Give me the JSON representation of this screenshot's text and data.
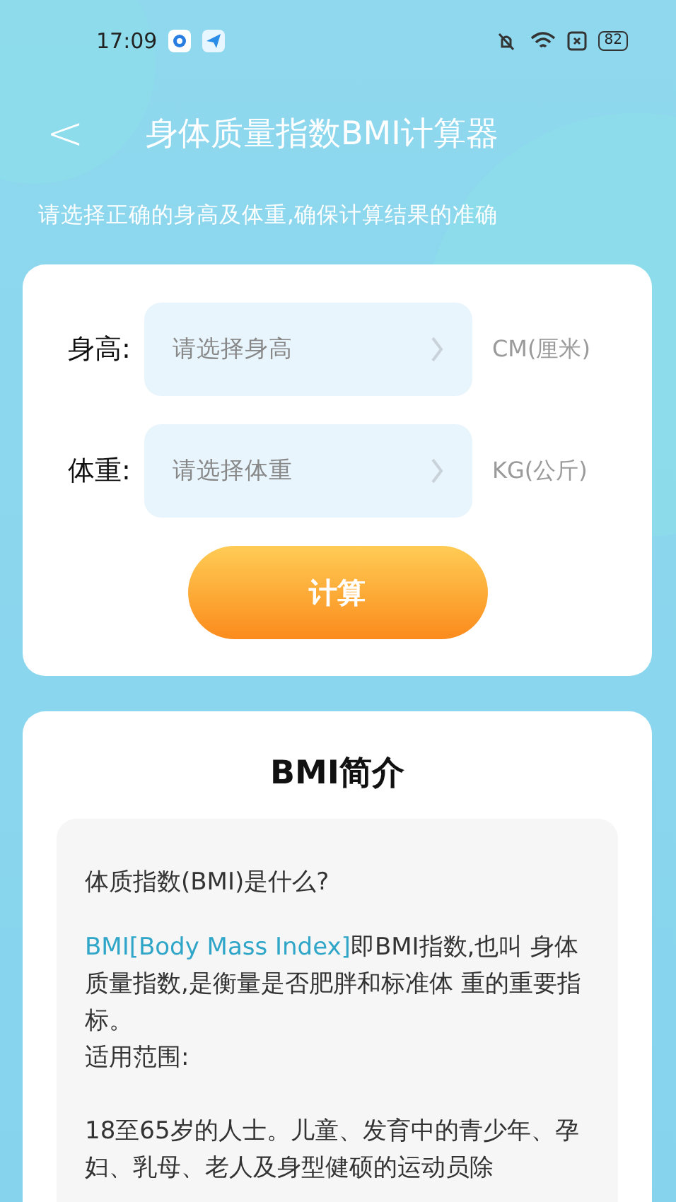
{
  "status_bar": {
    "time": "17:09",
    "battery": "82"
  },
  "header": {
    "back": "<",
    "title": "身体质量指数BMI计算器"
  },
  "hint": "请选择正确的身高及体重,确保计算结果的准确",
  "form": {
    "fields": [
      {
        "label": "身高:",
        "placeholder": "请选择身高",
        "unit": "CM(厘米)"
      },
      {
        "label": "体重:",
        "placeholder": "请选择体重",
        "unit": "KG(公斤)"
      }
    ],
    "button": "计算"
  },
  "intro": {
    "title": "BMI简介",
    "question": "体质指数(BMI)是什么?",
    "term": "BMI[Body Mass Index]",
    "definition": "即BMI指数,也叫 身体质量指数,是衡量是否肥胖和标准体 重的重要指标。",
    "scope_label": "适用范围:",
    "scope": "18至65岁的人士。儿童、发育中的青少年、孕妇、乳母、老人及身型健硕的运动员除"
  }
}
